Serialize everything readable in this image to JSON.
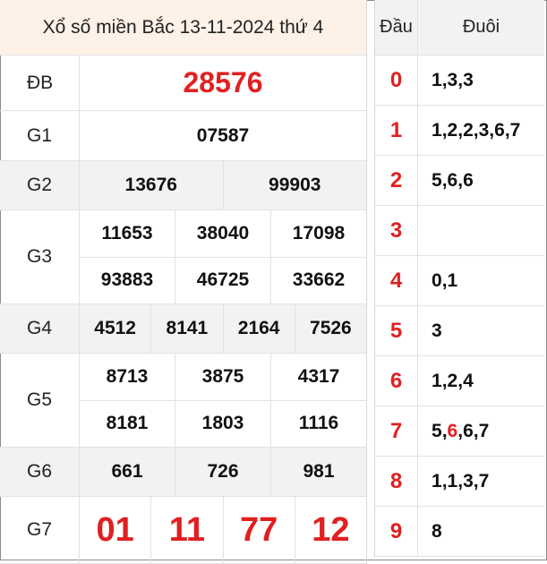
{
  "title": "Xổ số miền Bắc 13-11-2024 thứ 4",
  "prizes": [
    {
      "label": "ĐB",
      "rows": [
        [
          "28576"
        ]
      ]
    },
    {
      "label": "G1",
      "rows": [
        [
          "07587"
        ]
      ]
    },
    {
      "label": "G2",
      "rows": [
        [
          "13676",
          "99903"
        ]
      ]
    },
    {
      "label": "G3",
      "rows": [
        [
          "11653",
          "38040",
          "17098"
        ],
        [
          "93883",
          "46725",
          "33662"
        ]
      ]
    },
    {
      "label": "G4",
      "rows": [
        [
          "4512",
          "8141",
          "2164",
          "7526"
        ]
      ]
    },
    {
      "label": "G5",
      "rows": [
        [
          "8713",
          "3875",
          "4317"
        ],
        [
          "8181",
          "1803",
          "1116"
        ]
      ]
    },
    {
      "label": "G6",
      "rows": [
        [
          "661",
          "726",
          "981"
        ]
      ]
    },
    {
      "label": "G7",
      "rows": [
        [
          "01",
          "11",
          "77",
          "12"
        ]
      ]
    }
  ],
  "loto": {
    "head_label": "Đầu",
    "tail_label": "Đuôi",
    "rows": [
      {
        "head": "0",
        "tails": [
          "1",
          "3",
          "3"
        ]
      },
      {
        "head": "1",
        "tails": [
          "1",
          "2",
          "2",
          "3",
          "6",
          "7"
        ]
      },
      {
        "head": "2",
        "tails": [
          "5",
          "6",
          "6"
        ]
      },
      {
        "head": "3",
        "tails": []
      },
      {
        "head": "4",
        "tails": [
          "0",
          "1"
        ]
      },
      {
        "head": "5",
        "tails": [
          "3"
        ]
      },
      {
        "head": "6",
        "tails": [
          "1",
          "2",
          "4"
        ]
      },
      {
        "head": "7",
        "tails": [
          "5",
          "6",
          "6",
          "7"
        ],
        "highlight_index": 1
      },
      {
        "head": "8",
        "tails": [
          "1",
          "1",
          "3",
          "7"
        ]
      },
      {
        "head": "9",
        "tails": [
          "8"
        ]
      }
    ]
  },
  "colors": {
    "accent_red": "#e02020",
    "title_bg": "#fef1e7",
    "shade_bg": "#f2f2f2"
  }
}
